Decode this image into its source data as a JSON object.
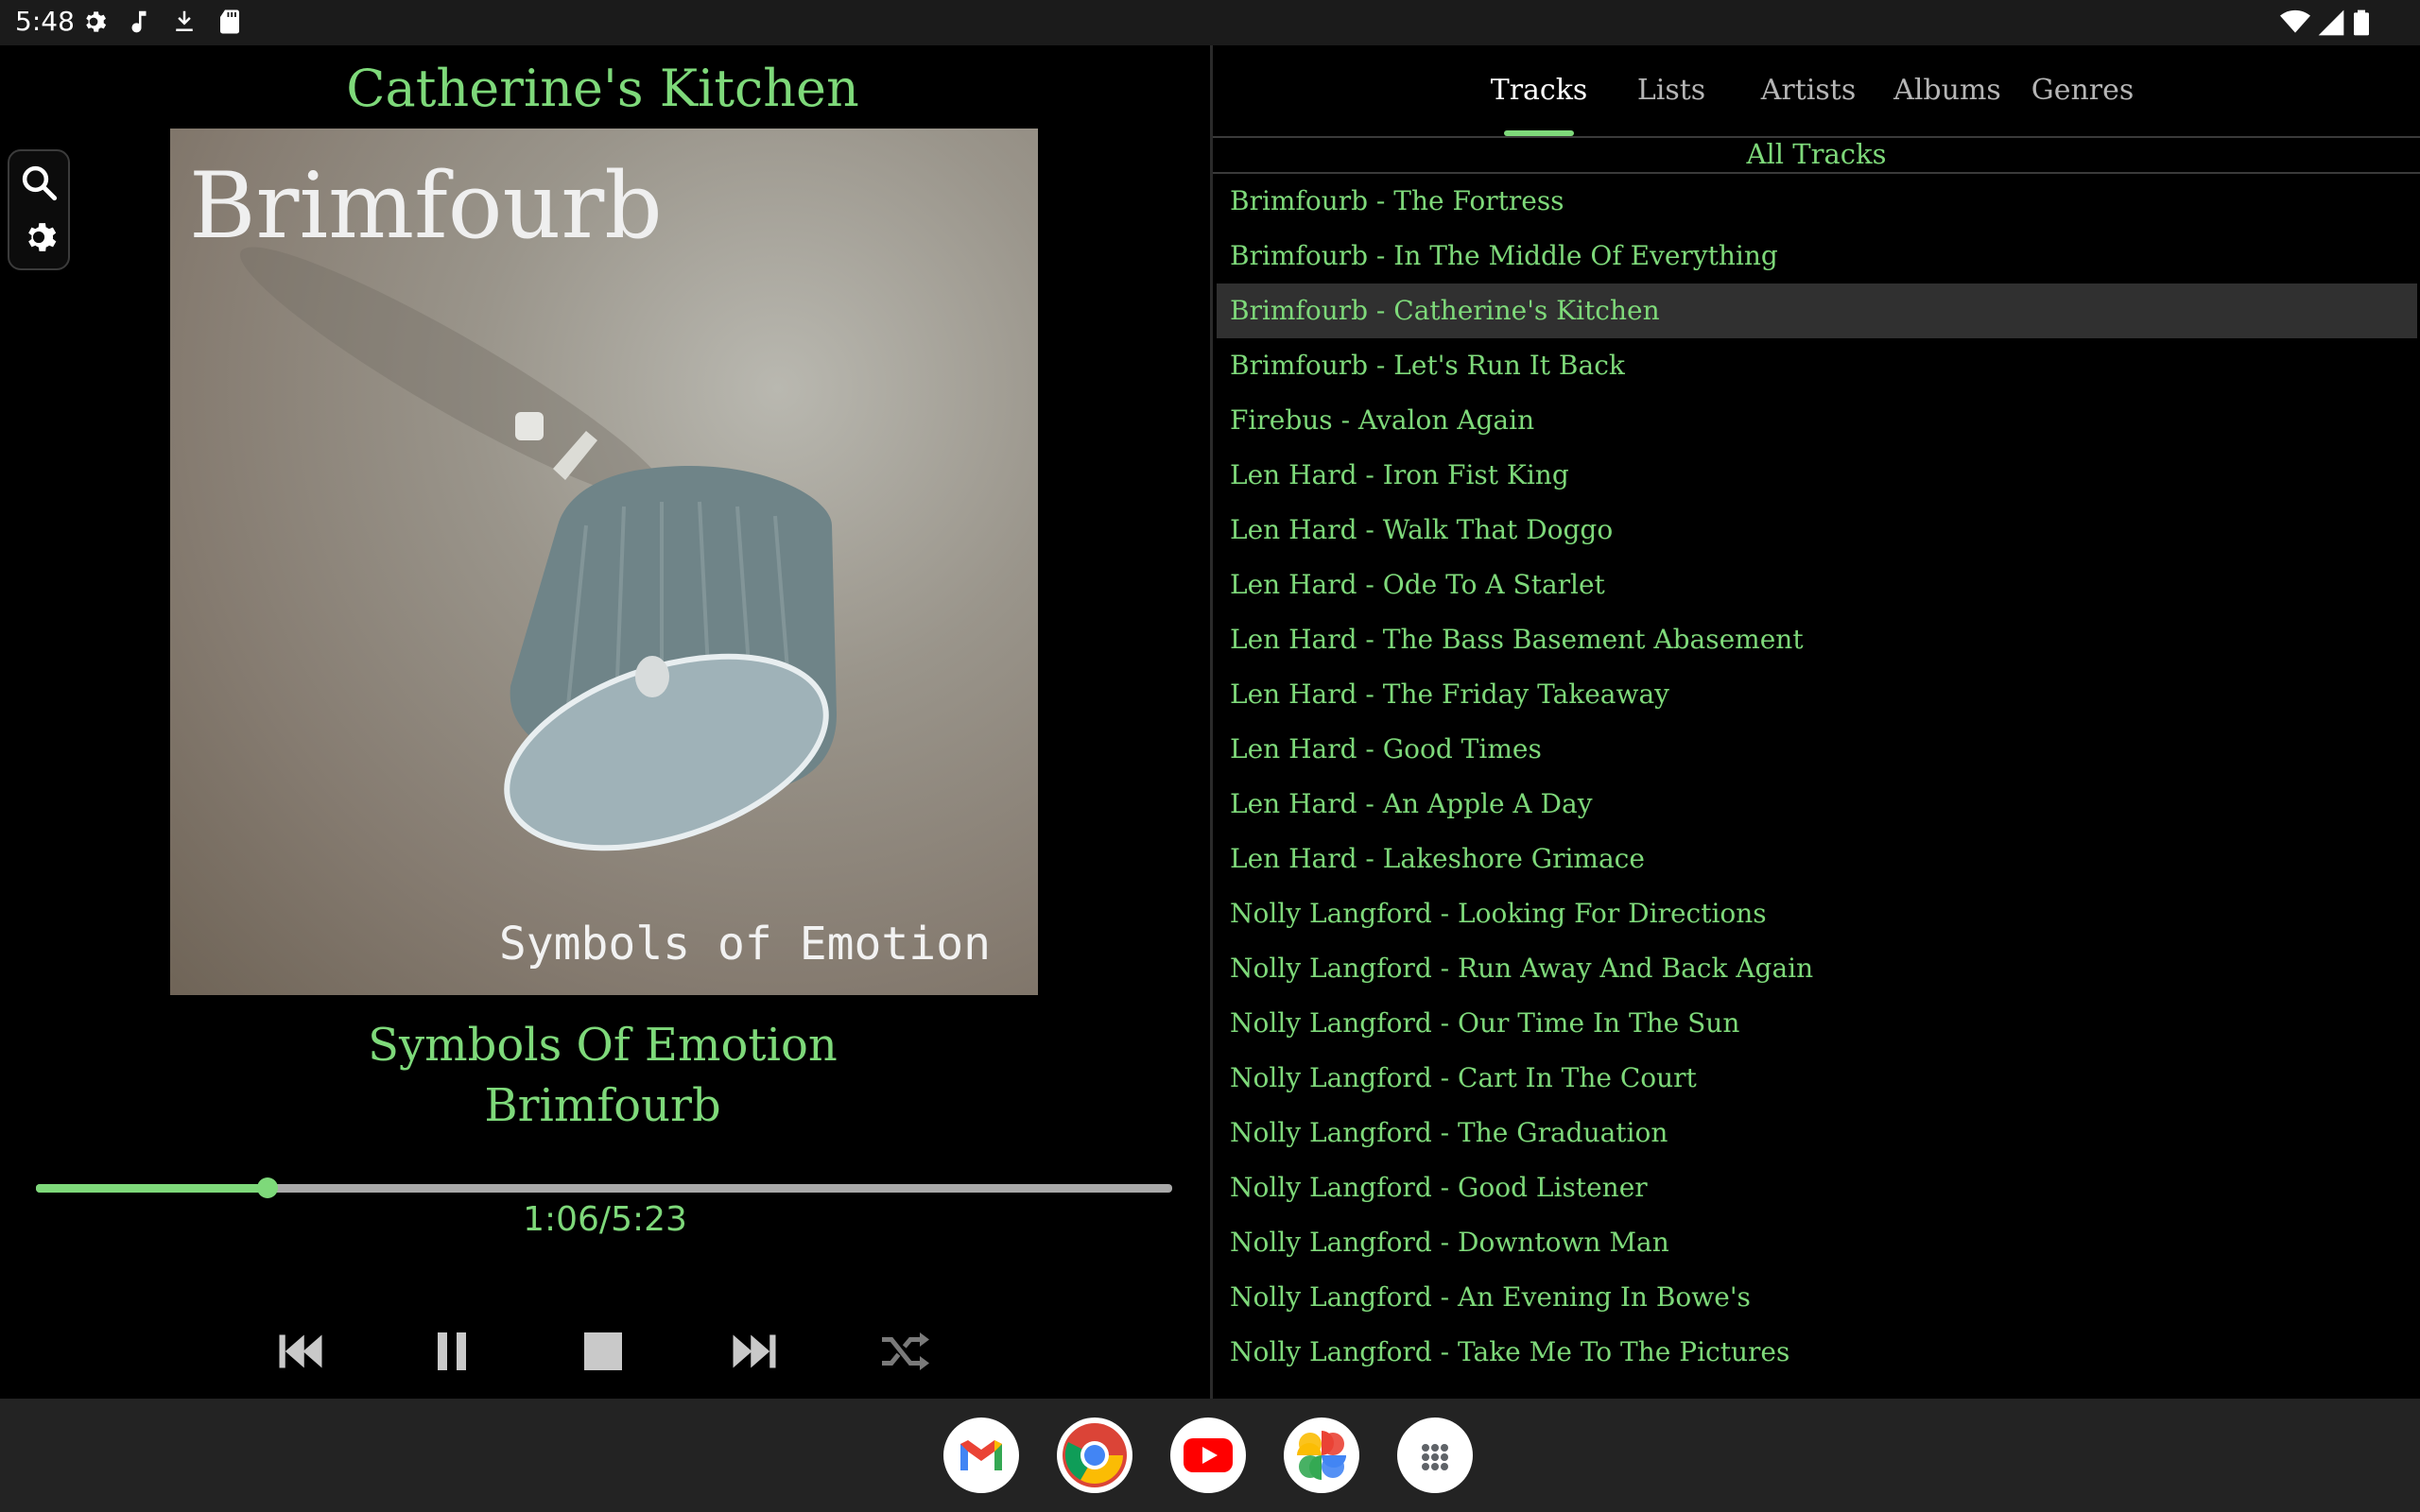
{
  "status_bar": {
    "time": "5:48",
    "icons": [
      "settings-gear-icon",
      "music-note-icon",
      "download-icon",
      "sd-card-icon"
    ],
    "right_icons": [
      "wifi-icon",
      "signal-icon",
      "battery-icon"
    ]
  },
  "player": {
    "now_playing_title": "Catherine's Kitchen",
    "cover_art": {
      "artist_text": "Brimfourb",
      "album_text": "Symbols of Emotion"
    },
    "album": "Symbols Of Emotion",
    "artist": "Brimfourb",
    "progress": {
      "elapsed": "1:06",
      "total": "5:23",
      "display": "1:06/5:23",
      "fraction": 0.204
    },
    "controls": [
      "skip-previous-icon",
      "pause-icon",
      "stop-icon",
      "skip-next-icon",
      "shuffle-icon"
    ],
    "side_tools": [
      "search-icon",
      "settings-icon"
    ]
  },
  "library": {
    "tabs": [
      {
        "label": "Tracks",
        "active": true
      },
      {
        "label": "Lists",
        "active": false
      },
      {
        "label": "Artists",
        "active": false
      },
      {
        "label": "Albums",
        "active": false
      },
      {
        "label": "Genres",
        "active": false
      }
    ],
    "heading": "All Tracks",
    "tracks": [
      "Brimfourb - The Fortress",
      "Brimfourb - In The Middle Of Everything",
      "Brimfourb - Catherine's Kitchen",
      "Brimfourb - Let's Run It Back",
      "Firebus - Avalon Again",
      "Len Hard - Iron Fist King",
      "Len Hard - Walk That Doggo",
      "Len Hard - Ode To A Starlet",
      "Len Hard - The Bass Basement Abasement",
      "Len Hard - The Friday Takeaway",
      "Len Hard - Good Times",
      "Len Hard - An Apple A Day",
      "Len Hard - Lakeshore Grimace",
      "Nolly Langford - Looking For Directions",
      "Nolly Langford - Run Away And Back Again",
      "Nolly Langford - Our Time In The Sun",
      "Nolly Langford - Cart In The Court",
      "Nolly Langford - The Graduation",
      "Nolly Langford - Good Listener",
      "Nolly Langford - Downtown Man",
      "Nolly Langford - An Evening In Bowe's",
      "Nolly Langford - Take Me To The Pictures"
    ],
    "selected_track": "Brimfourb - Catherine's Kitchen"
  },
  "dock": {
    "apps": [
      "gmail-icon",
      "chrome-icon",
      "youtube-icon",
      "photos-icon",
      "app-drawer-icon"
    ]
  },
  "colors": {
    "accent": "#7ed97a",
    "background": "#000000",
    "selected_row": "#303030"
  }
}
